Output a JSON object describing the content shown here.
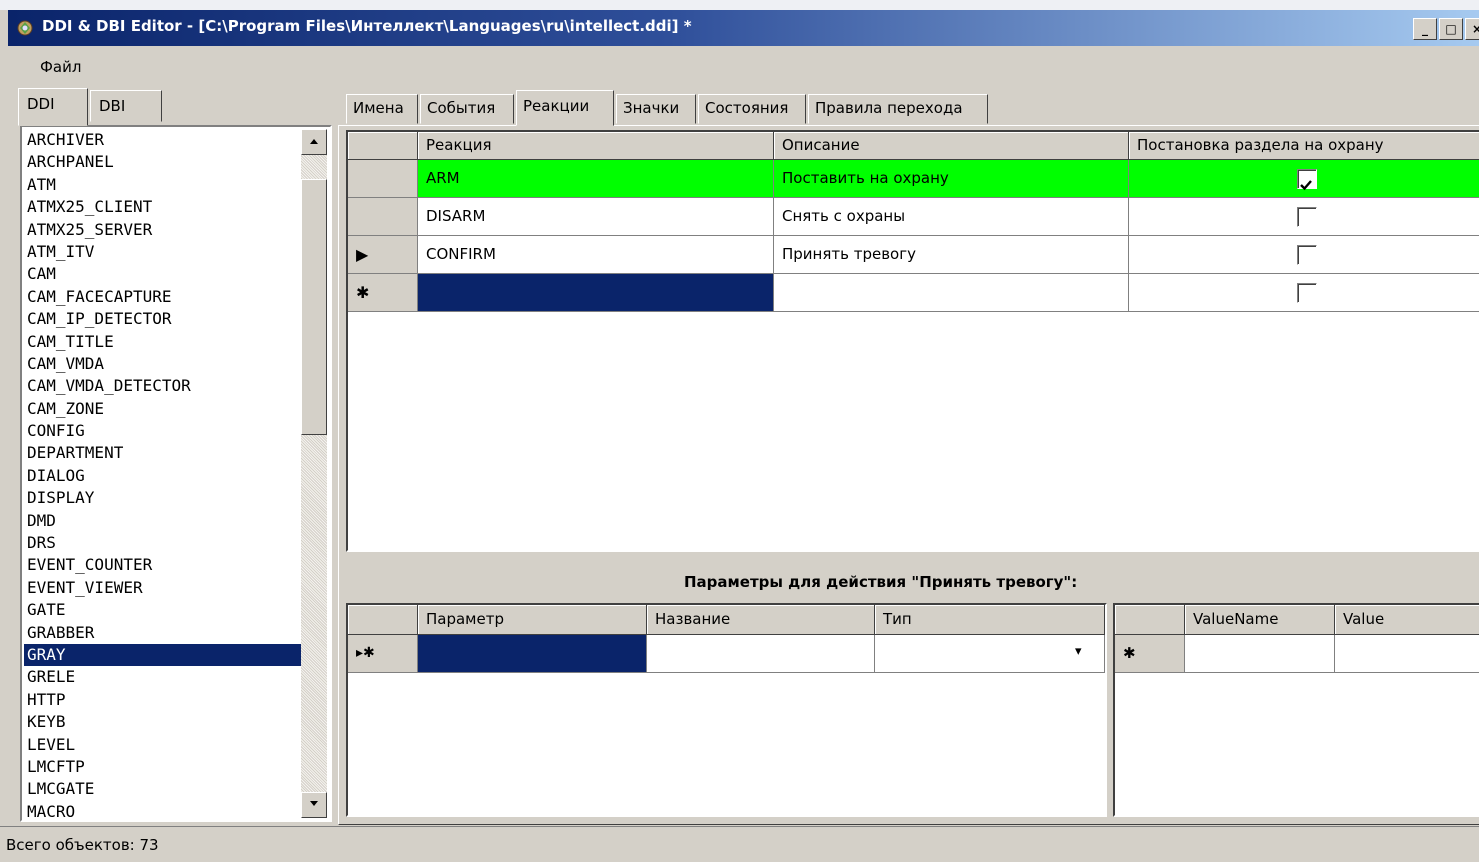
{
  "window": {
    "title": "DDI & DBI Editor - [C:\\Program Files\\Интеллект\\Languages\\ru\\intellect.ddi] *",
    "minimize": "_",
    "maximize": "□",
    "close": "×"
  },
  "menu": {
    "file": "Файл"
  },
  "left_tabs": [
    "DDI",
    "DBI"
  ],
  "objects": [
    "ARCHIVER",
    "ARCHPANEL",
    "ATM",
    "ATMX25_CLIENT",
    "ATMX25_SERVER",
    "ATM_ITV",
    "CAM",
    "CAM_FACECAPTURE",
    "CAM_IP_DETECTOR",
    "CAM_TITLE",
    "CAM_VMDA",
    "CAM_VMDA_DETECTOR",
    "CAM_ZONE",
    "CONFIG",
    "DEPARTMENT",
    "DIALOG",
    "DISPLAY",
    "DMD",
    "DRS",
    "EVENT_COUNTER",
    "EVENT_VIEWER",
    "GATE",
    "GRABBER",
    "GRAY",
    "GRELE",
    "HTTP",
    "KEYB",
    "LEVEL",
    "LMCFTP",
    "LMCGATE",
    "MACRO"
  ],
  "selected_object": "GRAY",
  "right_tabs": [
    "Имена",
    "События",
    "Реакции",
    "Значки",
    "Состояния",
    "Правила перехода"
  ],
  "active_tab": "Реакции",
  "reactions": {
    "headers": [
      "Реакция",
      "Описание",
      "Постановка раздела на охрану"
    ],
    "rows": [
      {
        "indicator": "",
        "reaction": "ARM",
        "description": "Поставить на охрану",
        "checked": true,
        "highlight": "#00ff00"
      },
      {
        "indicator": "",
        "reaction": "DISARM",
        "description": "Снять с охраны",
        "checked": false
      },
      {
        "indicator": "▶",
        "reaction": "CONFIRM",
        "description": "Принять тревогу",
        "checked": false
      },
      {
        "indicator": "✱",
        "reaction": "",
        "description": "",
        "checked": false
      }
    ]
  },
  "params_title": "Параметры для действия \"Принять тревогу\":",
  "params": {
    "headers": [
      "Параметр",
      "Название",
      "Тип"
    ],
    "new_row_indicator": "▸✱",
    "dropdown_glyph": "▾"
  },
  "values": {
    "headers": [
      "ValueName",
      "Value"
    ],
    "new_row_indicator": "✱"
  },
  "status": "Всего объектов: 73",
  "colors": {
    "selection": "#0a246a",
    "highlight_row": "#00ff00",
    "face": "#d4d0c8"
  }
}
